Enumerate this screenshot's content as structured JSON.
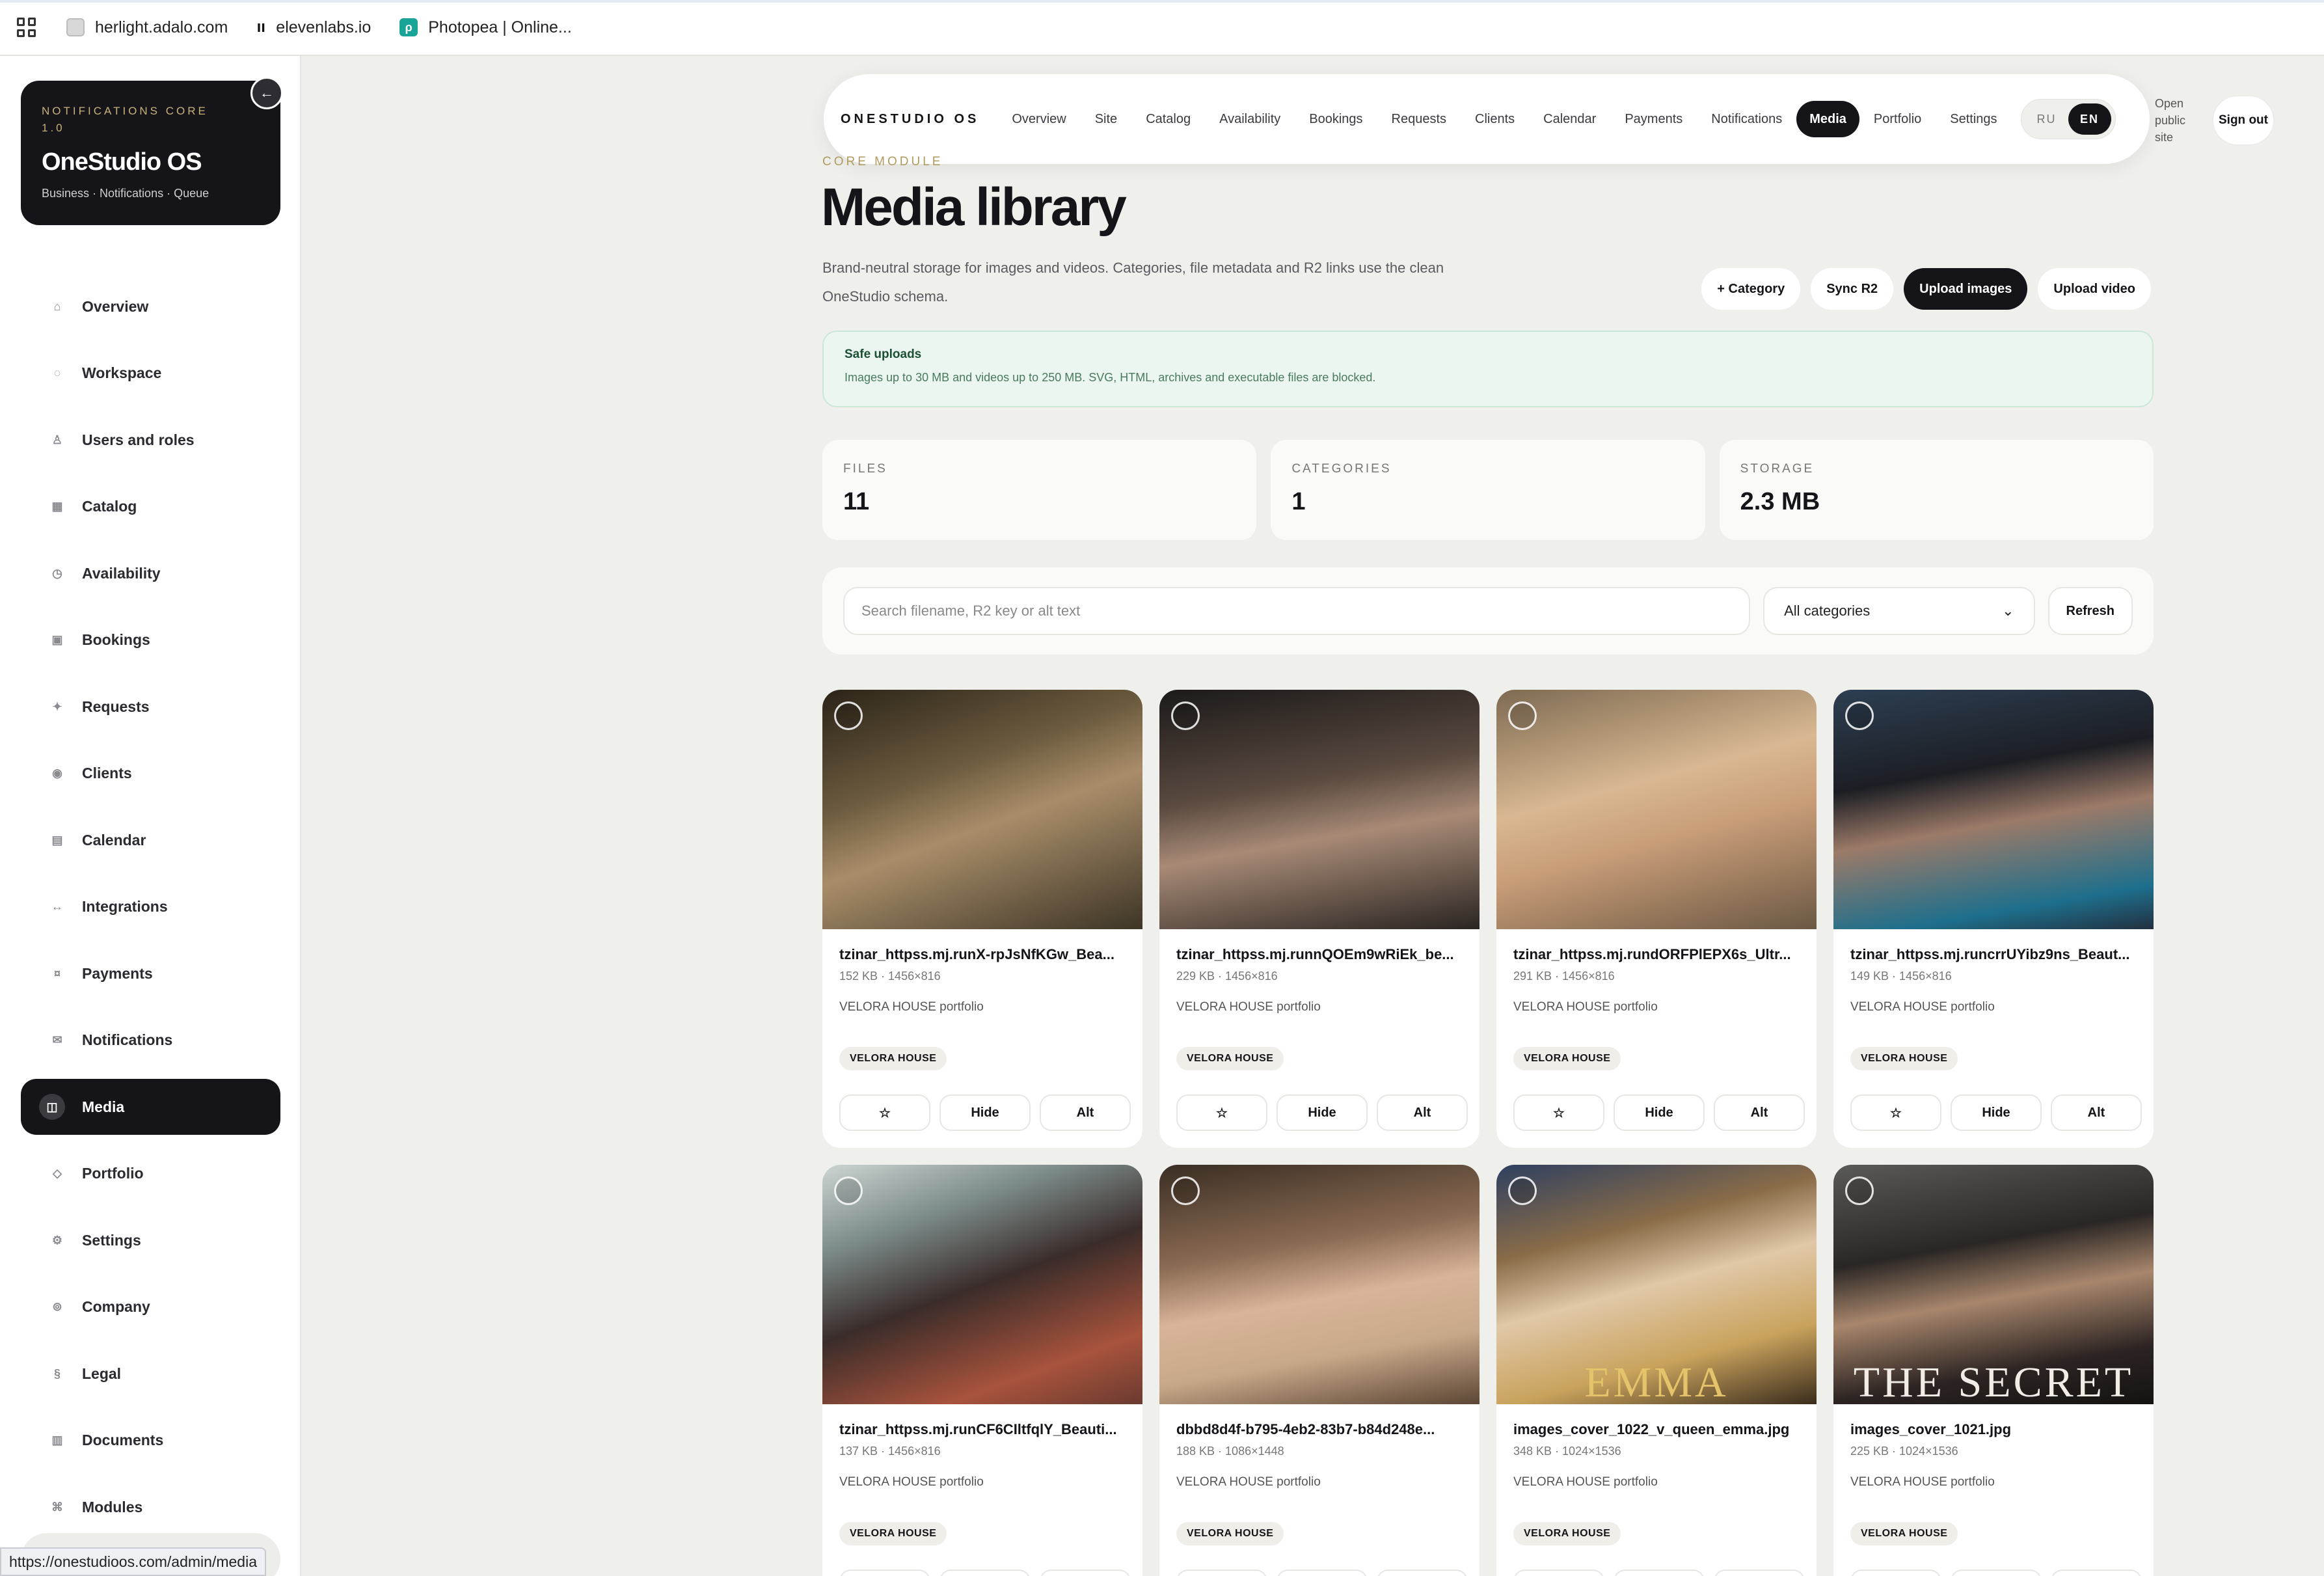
{
  "browser": {
    "bookmarks": [
      {
        "label": "herlight.adalo.com",
        "icon": "herlight-favicon"
      },
      {
        "label": "elevenlabs.io",
        "icon": "elevenlabs-favicon"
      },
      {
        "label": "Photopea | Online...",
        "icon": "photopea-favicon"
      }
    ],
    "status_url": "https://onestudioos.com/admin/media"
  },
  "sidebar": {
    "brand": {
      "kicker": "NOTIFICATIONS CORE 1.0",
      "title": "OneStudio OS",
      "subtitle": "Business · Notifications · Queue",
      "collapse_glyph": "←"
    },
    "items": [
      {
        "label": "Overview",
        "icon": "⌂"
      },
      {
        "label": "Workspace",
        "icon": "◌"
      },
      {
        "label": "Users and roles",
        "icon": "♙"
      },
      {
        "label": "Catalog",
        "icon": "▦"
      },
      {
        "label": "Availability",
        "icon": "◷"
      },
      {
        "label": "Bookings",
        "icon": "▣"
      },
      {
        "label": "Requests",
        "icon": "✦"
      },
      {
        "label": "Clients",
        "icon": "◉"
      },
      {
        "label": "Calendar",
        "icon": "▤"
      },
      {
        "label": "Integrations",
        "icon": "↔"
      },
      {
        "label": "Payments",
        "icon": "¤"
      },
      {
        "label": "Notifications",
        "icon": "✉"
      },
      {
        "label": "Media",
        "icon": "◫",
        "active": true
      },
      {
        "label": "Portfolio",
        "icon": "◇"
      },
      {
        "label": "Settings",
        "icon": "⚙"
      },
      {
        "label": "Company",
        "icon": "⊚"
      },
      {
        "label": "Legal",
        "icon": "§"
      },
      {
        "label": "Documents",
        "icon": "▥"
      },
      {
        "label": "Modules",
        "icon": "⌘"
      }
    ]
  },
  "topnav": {
    "logo": "ONESTUDIO OS",
    "tabs": [
      "Overview",
      "Site",
      "Catalog",
      "Availability",
      "Bookings",
      "Requests",
      "Clients",
      "Calendar",
      "Payments",
      "Notifications",
      "Media",
      "Portfolio",
      "Settings"
    ],
    "active_tab": "Media",
    "lang": [
      "RU",
      "EN"
    ],
    "active_lang": "EN",
    "open_public_site": "Open public site",
    "sign_out": "Sign out"
  },
  "header": {
    "kicker": "CORE MODULE",
    "title": "Media library",
    "description": "Brand-neutral storage for images and videos. Categories, file metadata and R2 links use the clean OneStudio schema.",
    "actions": [
      "+ Category",
      "Sync R2",
      "Upload images",
      "Upload video"
    ]
  },
  "notice": {
    "title": "Safe uploads",
    "text": "Images up to 30 MB and videos up to 250 MB. SVG, HTML, archives and executable files are blocked."
  },
  "stats": [
    {
      "label": "FILES",
      "value": "11"
    },
    {
      "label": "CATEGORIES",
      "value": "1"
    },
    {
      "label": "STORAGE",
      "value": "2.3 MB"
    }
  ],
  "toolbar": {
    "search_placeholder": "Search filename, R2 key or alt text",
    "category_selected": "All categories",
    "refresh": "Refresh"
  },
  "card_buttons": {
    "star": "☆",
    "hide": "Hide",
    "alt": "Alt"
  },
  "files": [
    {
      "name": "tzinar_httpss.mj.runX-rpJsNfKGw_Bea...",
      "meta": "152 KB · 1456×816",
      "portfolio": "VELORA HOUSE portfolio",
      "tag": "VELORA HOUSE",
      "overlay": ""
    },
    {
      "name": "tzinar_httpss.mj.runnQOEm9wRiEk_be...",
      "meta": "229 KB · 1456×816",
      "portfolio": "VELORA HOUSE portfolio",
      "tag": "VELORA HOUSE",
      "overlay": ""
    },
    {
      "name": "tzinar_httpss.mj.rundORFPlEPX6s_Ultr...",
      "meta": "291 KB · 1456×816",
      "portfolio": "VELORA HOUSE portfolio",
      "tag": "VELORA HOUSE",
      "overlay": ""
    },
    {
      "name": "tzinar_httpss.mj.runcrrUYibz9ns_Beaut...",
      "meta": "149 KB · 1456×816",
      "portfolio": "VELORA HOUSE portfolio",
      "tag": "VELORA HOUSE",
      "overlay": ""
    },
    {
      "name": "tzinar_httpss.mj.runCF6CIltfqlY_Beauti...",
      "meta": "137 KB · 1456×816",
      "portfolio": "VELORA HOUSE portfolio",
      "tag": "VELORA HOUSE",
      "overlay": ""
    },
    {
      "name": "dbbd8d4f-b795-4eb2-83b7-b84d248e...",
      "meta": "188 KB · 1086×1448",
      "portfolio": "VELORA HOUSE portfolio",
      "tag": "VELORA HOUSE",
      "overlay": ""
    },
    {
      "name": "images_cover_1022_v_queen_emma.jpg",
      "meta": "348 KB · 1024×1536",
      "portfolio": "VELORA HOUSE portfolio",
      "tag": "VELORA HOUSE",
      "overlay": "EMMA"
    },
    {
      "name": "images_cover_1021.jpg",
      "meta": "225 KB · 1024×1536",
      "portfolio": "VELORA HOUSE portfolio",
      "tag": "VELORA HOUSE",
      "overlay": "THE SECRET"
    }
  ],
  "colors": {
    "accent_dark": "#141419",
    "gold": "#b19a5f",
    "notice_bg": "#eaf6ef",
    "thumbs": [
      "linear-gradient(160deg,#2b2418 0%,#6b5a3e 35%,#a98d6a 55%,#3d3526 100%)",
      "linear-gradient(170deg,#1c1a19 0%,#5a4a40 40%,#a88a76 60%,#2a2522 100%)",
      "linear-gradient(165deg,#7e6a52 0%,#d8b892 40%,#c99d78 60%,#6b5844 100%)",
      "linear-gradient(170deg,#2d3f52 0%,#1c1e24 35%,#9c7a68 55%,#1e6f8c 85%,#223040 100%)",
      "linear-gradient(160deg,#cdd5d2 0%,#7c8c8a 25%,#3a2c2a 50%,#a8533c 80%,#6a3a30 100%)",
      "linear-gradient(170deg,#3a2e24 0%,#8a6a52 35%,#d8b49a 55%,#c8a88a 75%,#5c4634 100%)",
      "linear-gradient(165deg,#2e4060 0%,#8a6c48 30%,#e0c8a8 50%,#c9a25c 75%,#3a2c1c 100%)",
      "linear-gradient(170deg,#5a5a58 0%,#2a2624 35%,#a8866c 55%,#2c2422 80%,#141210 100%)"
    ]
  }
}
